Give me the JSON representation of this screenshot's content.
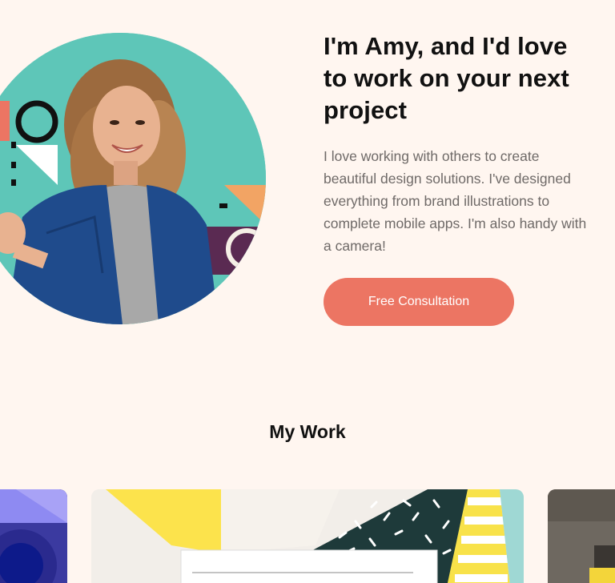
{
  "hero": {
    "image_alt": "Portrait of Amy with colorful geometric shapes",
    "title": "I'm Amy, and I'd love to work on your next project",
    "description": "I love working with others to create beautiful design solutions. I've designed everything from brand illustrations to complete mobile apps. I'm also handy with a camera!",
    "cta_label": "Free Consultation"
  },
  "work": {
    "title": "My Work",
    "cards": [
      {
        "image": "blue geometric artwork"
      },
      {
        "image": "yellow and teal paper collage"
      },
      {
        "image": "desk photo with yellow note"
      }
    ]
  },
  "colors": {
    "background": "#fff6f0",
    "accent": "#ec7563",
    "teal": "#5ec6b8",
    "text": "#111111",
    "muted": "#6f6a68"
  }
}
